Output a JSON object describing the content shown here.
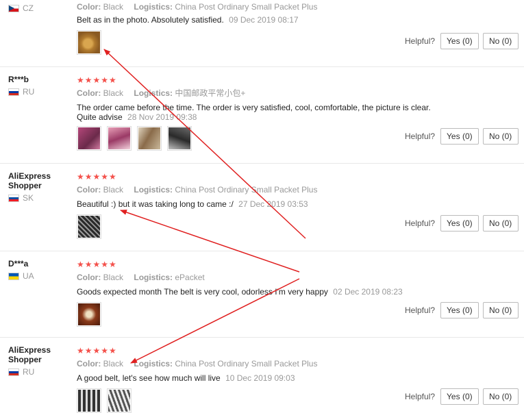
{
  "helpful_label": "Helpful?",
  "reviews": [
    {
      "user": "",
      "country": "CZ",
      "stars": "",
      "color_label": "Color:",
      "color": "Black",
      "logistics_label": "Logistics:",
      "logistics": "China Post Ordinary Small Packet Plus",
      "text": "Belt as in the photo. Absolutely satisfied.",
      "date": "09 Dec 2019 08:17",
      "yes": "Yes (0)",
      "no": "No (0)"
    },
    {
      "user": "R***b",
      "country": "RU",
      "stars": "★★★★★",
      "color_label": "Color:",
      "color": "Black",
      "logistics_label": "Logistics:",
      "logistics": "中国邮政平常小包+",
      "text": "The order came before the time. The order is very satisfied, cool, comfortable, the picture is clear.",
      "text2": "Quite advise",
      "date": "28 Nov 2019 09:38",
      "yes": "Yes (0)",
      "no": "No (0)"
    },
    {
      "user": "AliExpress Shopper",
      "country": "SK",
      "stars": "★★★★★",
      "color_label": "Color:",
      "color": "Black",
      "logistics_label": "Logistics:",
      "logistics": "China Post Ordinary Small Packet Plus",
      "text": "Beautiful :) but it was taking long to came :/",
      "date": "27 Dec 2019 03:53",
      "yes": "Yes (0)",
      "no": "No (0)"
    },
    {
      "user": "D***a",
      "country": "UA",
      "stars": "★★★★★",
      "color_label": "Color:",
      "color": "Black",
      "logistics_label": "Logistics:",
      "logistics": "ePacket",
      "text": "Goods expected month The belt is very cool, odorless I'm very happy",
      "date": "02 Dec 2019 08:23",
      "yes": "Yes (0)",
      "no": "No (0)"
    },
    {
      "user": "AliExpress Shopper",
      "country": "RU",
      "stars": "★★★★★",
      "color_label": "Color:",
      "color": "Black",
      "logistics_label": "Logistics:",
      "logistics": "China Post Ordinary Small Packet Plus",
      "text": "A good belt, let's see how much will live",
      "date": "10 Dec 2019 09:03",
      "yes": "Yes (0)",
      "no": "No (0)"
    }
  ],
  "colors": {
    "star": "#f4514b",
    "arrow": "#e02020"
  }
}
